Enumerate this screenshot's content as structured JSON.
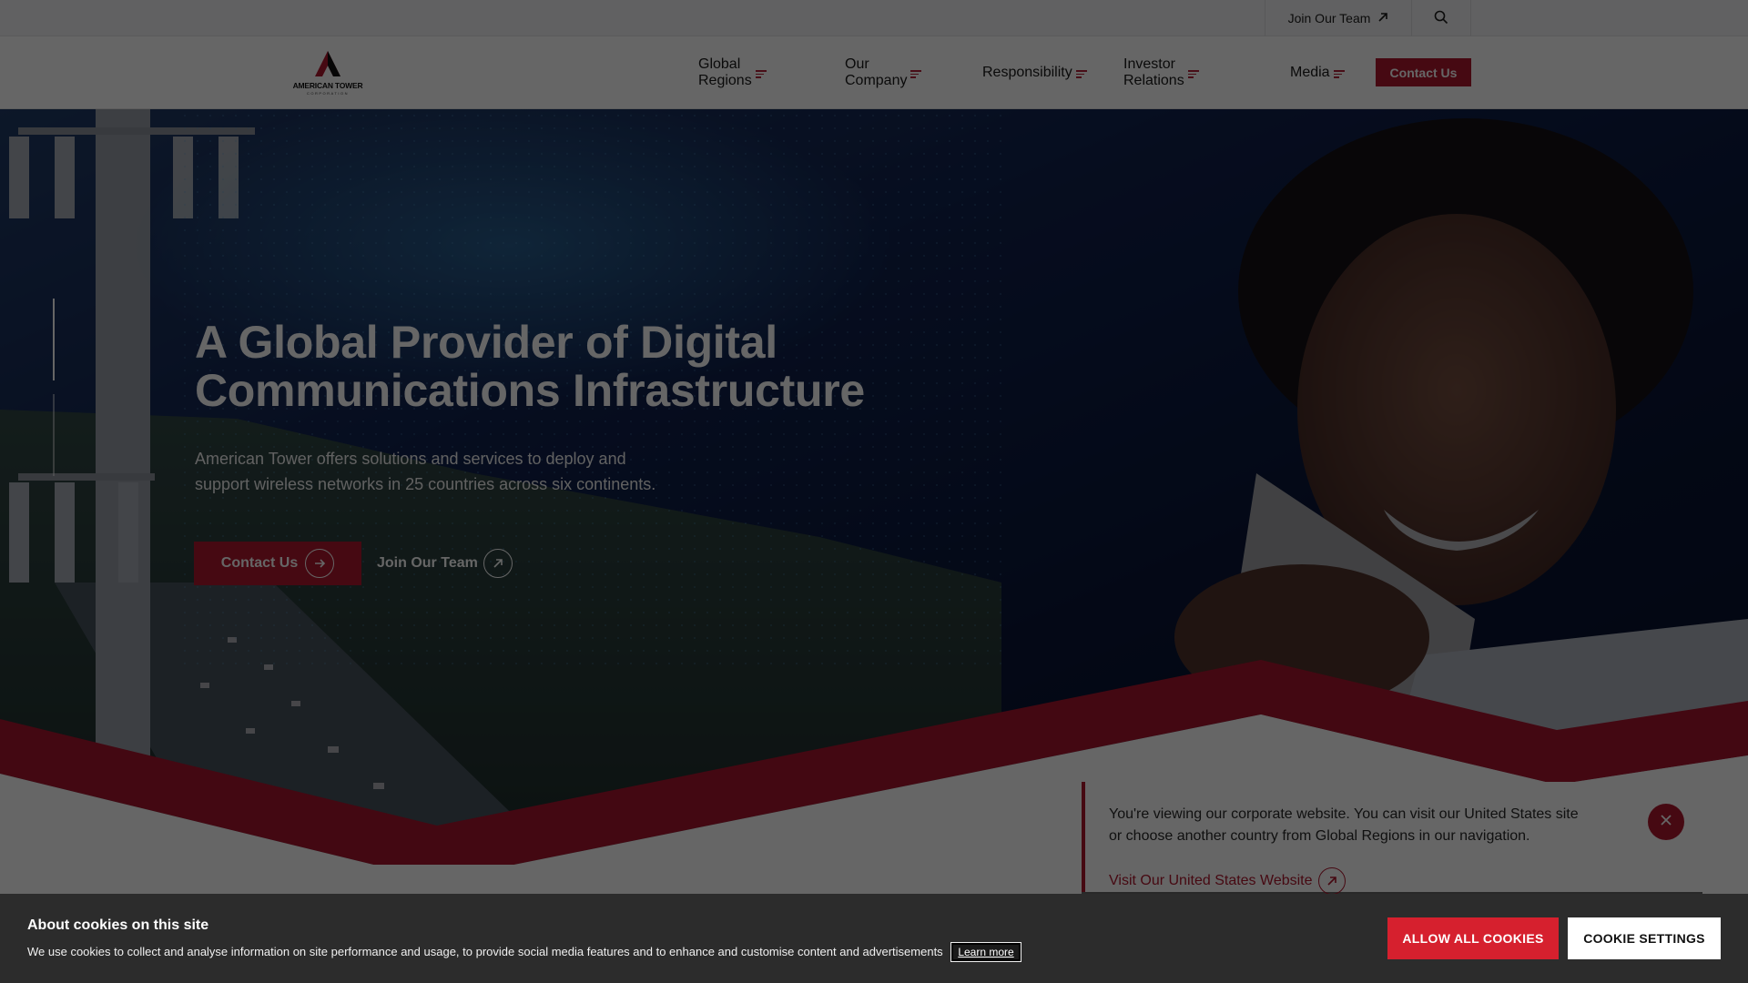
{
  "utility_bar": {
    "join_team": "Join Our Team",
    "join_team_icon": "arrow-up-right-icon",
    "search_icon": "search-icon"
  },
  "header": {
    "logo_text": "AMERICAN TOWER",
    "logo_subtext": "CORPORATION",
    "nav": [
      {
        "label": "Global Regions"
      },
      {
        "label": "Our Company"
      },
      {
        "label": "Responsibility"
      },
      {
        "label": "Investor Relations"
      },
      {
        "label": "Media"
      }
    ],
    "contact_label": "Contact Us"
  },
  "hero": {
    "title": "A Global Provider of Digital Communications Infrastructure",
    "description": "American Tower offers solutions and services to deploy and support wireless networks in 25 countries across six continents.",
    "contact_label": "Contact Us",
    "join_label": "Join Our Team"
  },
  "region_notice": {
    "text": "You're viewing our corporate website. You can visit our United States site or choose another country from Global Regions in our navigation.",
    "link_label": "Visit Our United States Website"
  },
  "cookie_banner": {
    "title": "About cookies on this site",
    "text": "We use cookies to collect and analyse information on site performance and usage, to provide social media features and to enhance and customise content and advertisements",
    "learn_more": "Learn more",
    "allow_all": "ALLOW ALL COOKIES",
    "settings": "COOKIE SETTINGS"
  },
  "colors": {
    "brand_red": "#b0172e",
    "cookie_red": "#d6202e",
    "navy": "#0c1a3d"
  }
}
